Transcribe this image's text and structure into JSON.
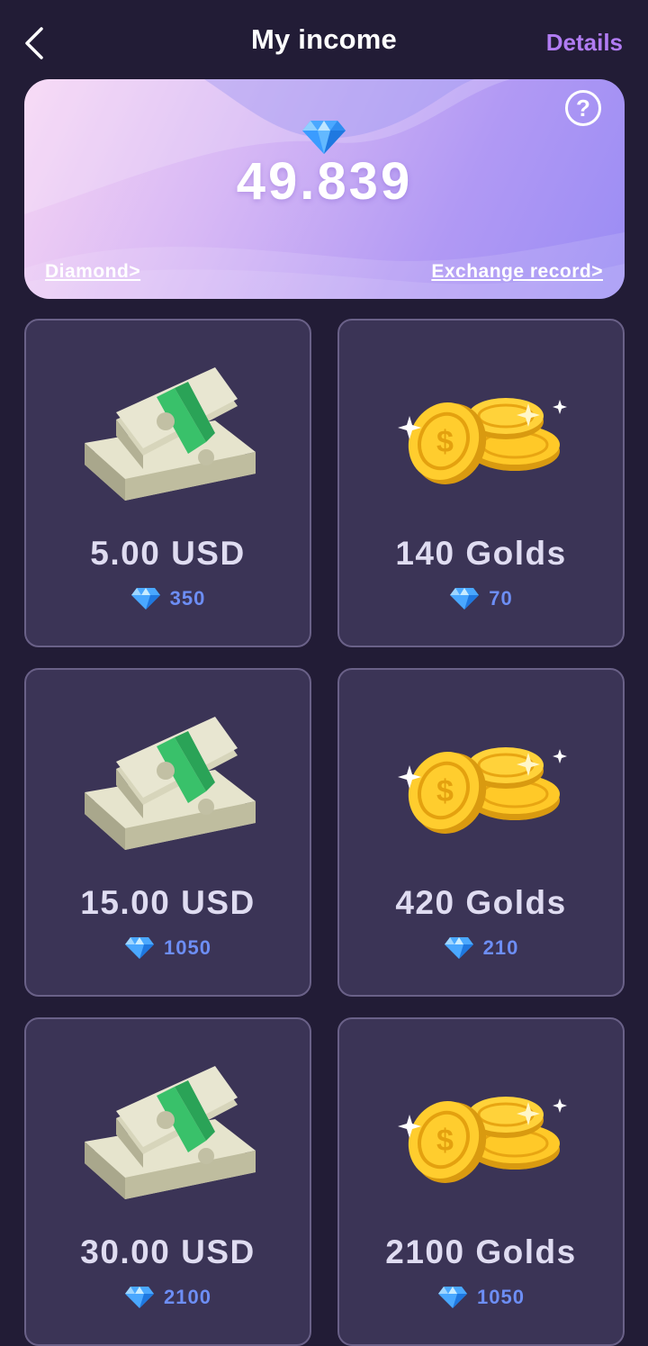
{
  "header": {
    "title": "My income",
    "details_label": "Details"
  },
  "balance": {
    "amount": "49.839",
    "diamond_link": "Diamond>",
    "exchange_link": "Exchange record>"
  },
  "items": [
    {
      "type": "usd",
      "icon": "cash-stack-icon",
      "amount": "5.00 USD",
      "price": "350"
    },
    {
      "type": "gold",
      "icon": "gold-coins-icon",
      "amount": "140 Golds",
      "price": "70"
    },
    {
      "type": "usd",
      "icon": "cash-stack-icon",
      "amount": "15.00 USD",
      "price": "1050"
    },
    {
      "type": "gold",
      "icon": "gold-coins-icon",
      "amount": "420 Golds",
      "price": "210"
    },
    {
      "type": "usd",
      "icon": "cash-stack-icon",
      "amount": "30.00 USD",
      "price": "2100"
    },
    {
      "type": "gold",
      "icon": "gold-coins-icon",
      "amount": "2100 Golds",
      "price": "1050"
    }
  ],
  "colors": {
    "background": "#221c36",
    "card": "#3b3456",
    "accent": "#b17cf3",
    "price_text": "#6d8ef5"
  }
}
